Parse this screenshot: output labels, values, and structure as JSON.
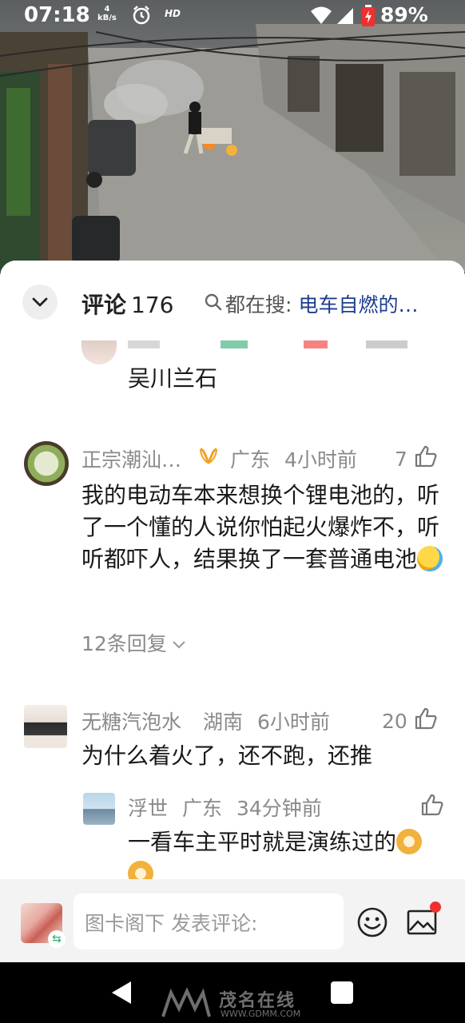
{
  "status_bar": {
    "time": "07:18",
    "net_speed_value": "4",
    "net_speed_unit": "kB/s",
    "hd": "HD",
    "battery": "89%"
  },
  "sheet": {
    "title": "评论",
    "count": "176",
    "search_label": "都在搜:",
    "search_keyword": "电车自燃的…"
  },
  "comments": [
    {
      "text": "吴川兰石"
    },
    {
      "name": "正宗潮汕…",
      "location": "广东",
      "time": "4小时前",
      "likes": "7",
      "text": "我的电动车本来想换个锂电池的，听了一个懂的人说你怕起火爆炸不，听听都吓人，结果换了一套普通电池",
      "replies": "12条回复"
    },
    {
      "name": "无糖汽泡水",
      "location": "湖南",
      "time": "6小时前",
      "likes": "20",
      "text": "为什么着火了，还不跑，还推"
    },
    {
      "name": "浮世",
      "location": "广东",
      "time": "34分钟前",
      "text": "一看车主平时就是演练过的"
    }
  ],
  "input_bar": {
    "placeholder": "图卡阁下 发表评论:"
  },
  "watermark": {
    "name": "茂名在线",
    "url": "WWW.GDMM.COM"
  },
  "icons": {
    "collapse": "chevron-down-icon",
    "search": "search-icon",
    "like": "thumbs-up-icon",
    "reply_expand": "chevron-down-icon",
    "emoji": "smiley-icon",
    "image": "image-icon"
  },
  "colors": {
    "search_keyword": "#1e3d8f",
    "meta_text": "#8a8a8a",
    "badge_red": "#f0302e"
  }
}
